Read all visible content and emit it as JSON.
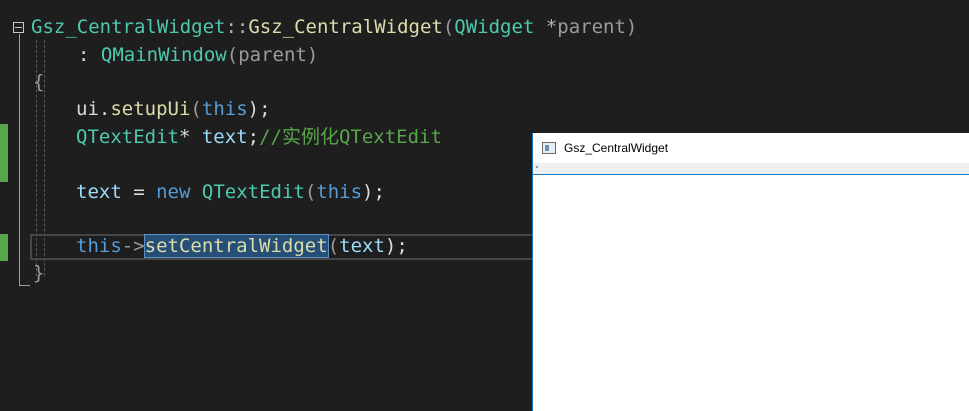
{
  "code": {
    "line1": {
      "class_name": "Gsz_CentralWidget",
      "scope": "::",
      "ctor_name": "Gsz_CentralWidget",
      "open_paren": "(",
      "param_type": "QWidget",
      "param_ptr": " *",
      "param_name": "parent",
      "close_paren": ")"
    },
    "line2": {
      "colon": ": ",
      "base_class": "QMainWindow",
      "open_paren": "(",
      "arg": "parent",
      "close_paren": ")"
    },
    "line3": {
      "brace": "{"
    },
    "line4": {
      "object": "ui",
      "dot": ".",
      "method": "setupUi",
      "open_paren": "(",
      "arg": "this",
      "close": ");"
    },
    "line5": {
      "type": "QTextEdit",
      "ptr": "* ",
      "var": "text",
      "semi": ";",
      "comment": "//实例化QTextEdit"
    },
    "line6": {
      "var": "text",
      "assign": " = ",
      "new_kw": "new",
      "space": " ",
      "type": "QTextEdit",
      "open_paren": "(",
      "arg": "this",
      "close": ");"
    },
    "line7": {
      "this_kw": "this",
      "arrow": "->",
      "method": "setCentralWidget",
      "open_paren": "(",
      "arg": "text",
      "close": ");"
    },
    "line8": {
      "brace": "}"
    }
  },
  "qt_window": {
    "title": "Gsz_CentralWidget",
    "icon": "qt-app-window-icon"
  },
  "colors": {
    "editor_background": "#1e1e1e",
    "class": "#4ec9b0",
    "function": "#dcdcaa",
    "keyword": "#569cd6",
    "variable": "#9cdcfe",
    "comment": "#57a64a",
    "change_marker": "#57a64a",
    "selection": "#264f78",
    "window_border": "#1979ca"
  }
}
